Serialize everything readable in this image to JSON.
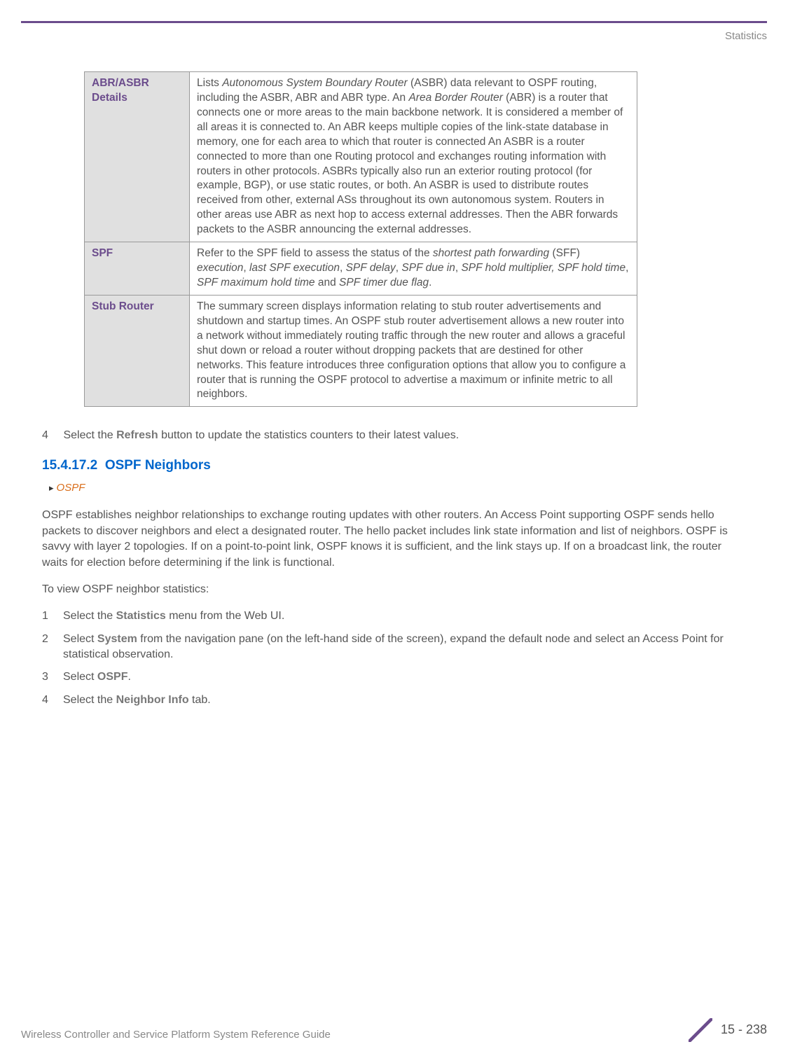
{
  "header": {
    "section_label": "Statistics"
  },
  "table": {
    "rows": [
      {
        "label": "ABR/ASBR Details",
        "desc_parts": [
          {
            "t": "Lists ",
            "i": false
          },
          {
            "t": "Autonomous System Boundary Router",
            "i": true
          },
          {
            "t": " (ASBR) data relevant to OSPF routing, including the ASBR, ABR and ABR type. An ",
            "i": false
          },
          {
            "t": "Area Border Router",
            "i": true
          },
          {
            "t": " (ABR) is a router that connects one or more areas to the main backbone network. It is considered a member of all areas it is connected to. An ABR keeps multiple copies of the link-state database in memory, one for each area to which that router is connected An ASBR is a router connected to more than one Routing protocol and exchanges routing information with routers in other protocols. ASBRs typically also run an exterior routing protocol (for example, BGP), or use static routes, or both. An ASBR is used to distribute routes received from other, external ASs throughout its own autonomous system. Routers in other areas use ABR as next hop to access external addresses. Then the ABR forwards packets to the ASBR announcing the external addresses.",
            "i": false
          }
        ]
      },
      {
        "label": "SPF",
        "desc_parts": [
          {
            "t": "Refer to the SPF field to assess the status of the ",
            "i": false
          },
          {
            "t": "shortest path forwarding",
            "i": true
          },
          {
            "t": " (SFF) ",
            "i": false
          },
          {
            "t": "execution",
            "i": true
          },
          {
            "t": ", ",
            "i": false
          },
          {
            "t": "last SPF execution",
            "i": true
          },
          {
            "t": ", ",
            "i": false
          },
          {
            "t": "SPF delay",
            "i": true
          },
          {
            "t": ", ",
            "i": false
          },
          {
            "t": "SPF due in",
            "i": true
          },
          {
            "t": ", ",
            "i": false
          },
          {
            "t": "SPF hold multiplier, SPF hold time",
            "i": true
          },
          {
            "t": ", ",
            "i": false
          },
          {
            "t": "SPF maximum hold time",
            "i": true
          },
          {
            "t": " and ",
            "i": false
          },
          {
            "t": "SPF timer due flag",
            "i": true
          },
          {
            "t": ".",
            "i": false
          }
        ]
      },
      {
        "label": "Stub Router",
        "desc_parts": [
          {
            "t": "The summary screen displays information relating to stub router advertisements and shutdown and startup times. An OSPF stub router advertisement allows a new router into a network without immediately routing traffic through the new router and allows a graceful shut down or reload a router without dropping packets that are destined for other networks. This feature introduces three configuration options that allow you to configure a router that is running the OSPF protocol to advertise a maximum or infinite metric to all neighbors.",
            "i": false
          }
        ]
      }
    ]
  },
  "pre_step": {
    "num": "4",
    "pre": "Select the ",
    "bold": "Refresh",
    "post": " button to update the statistics counters to their latest values."
  },
  "section": {
    "number": "15.4.17.2",
    "title": "OSPF Neighbors",
    "breadcrumb": "OSPF"
  },
  "intro": "OSPF establishes neighbor relationships to exchange routing updates with other routers. An Access Point supporting OSPF sends hello packets to discover neighbors and elect a designated router. The hello packet includes link state information and list of neighbors. OSPF is savvy with layer 2 topologies. If on a point-to-point link, OSPF knows it is sufficient, and the link stays up. If on a broadcast link, the router waits for election before determining if the link is functional.",
  "lead": "To view OSPF neighbor statistics:",
  "steps": [
    {
      "num": "1",
      "segs": [
        {
          "t": "Select the "
        },
        {
          "t": "Statistics",
          "b": true
        },
        {
          "t": " menu from the Web UI."
        }
      ]
    },
    {
      "num": "2",
      "segs": [
        {
          "t": "Select "
        },
        {
          "t": "System",
          "b": true
        },
        {
          "t": " from the navigation pane (on the left-hand side of the screen), expand the default node and select an Access Point for statistical observation."
        }
      ]
    },
    {
      "num": "3",
      "segs": [
        {
          "t": "Select "
        },
        {
          "t": "OSPF",
          "b": true
        },
        {
          "t": "."
        }
      ]
    },
    {
      "num": "4",
      "segs": [
        {
          "t": "Select the "
        },
        {
          "t": "Neighbor Info",
          "b": true
        },
        {
          "t": " tab."
        }
      ]
    }
  ],
  "footer": {
    "guide": "Wireless Controller and Service Platform System Reference Guide",
    "page": "15 - 238"
  }
}
